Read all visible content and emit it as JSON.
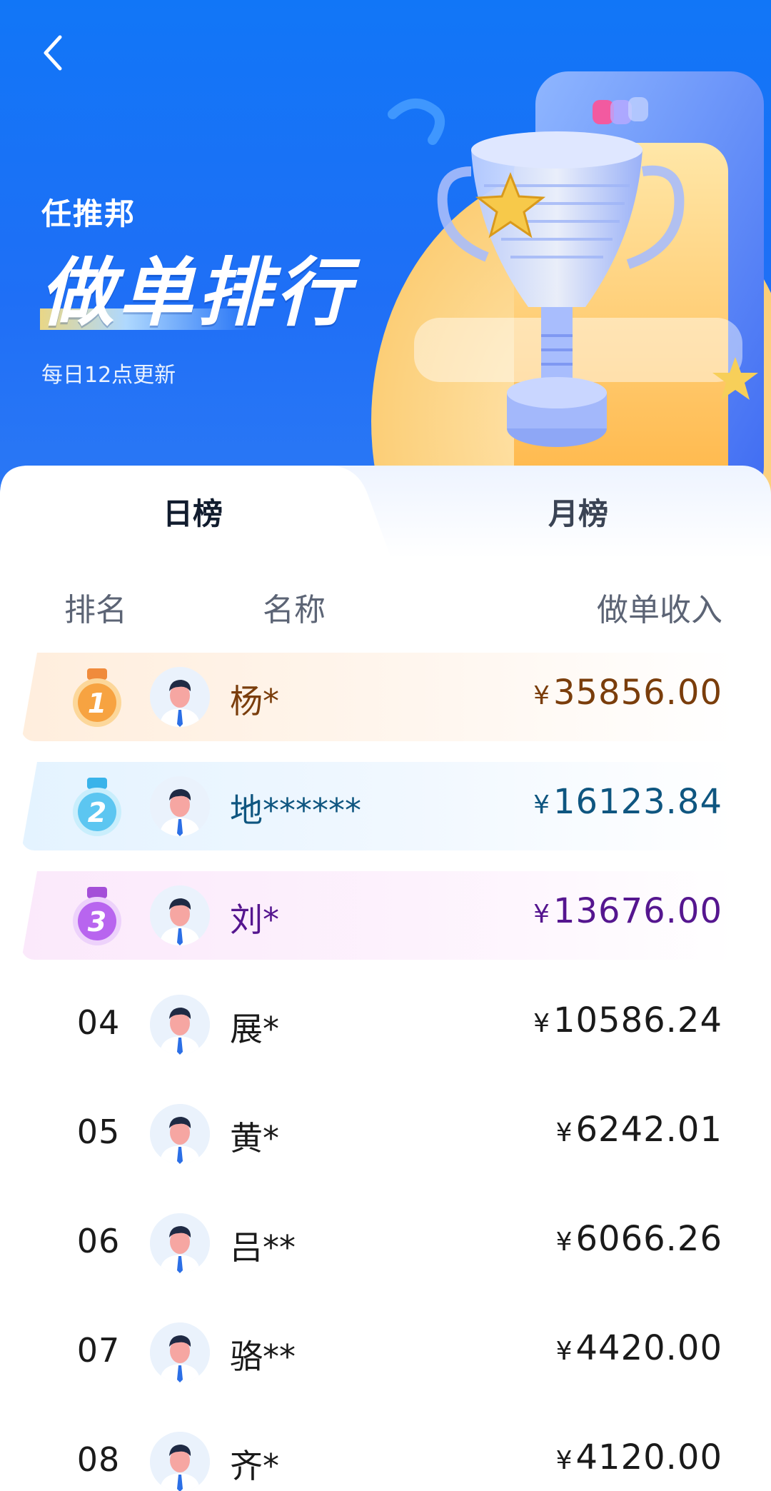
{
  "header": {
    "brand": "任推邦",
    "title": "做单排行",
    "subtitle": "每日12点更新"
  },
  "tabs": [
    {
      "label": "日榜",
      "active": true
    },
    {
      "label": "月榜",
      "active": false
    }
  ],
  "table": {
    "columns": [
      "排名",
      "名称",
      "做单收入"
    ],
    "currency": "¥",
    "rows": [
      {
        "rank": "01",
        "name": "杨*",
        "income": "35856.00"
      },
      {
        "rank": "02",
        "name": "地******",
        "income": "16123.84"
      },
      {
        "rank": "03",
        "name": "刘*",
        "income": "13676.00"
      },
      {
        "rank": "04",
        "name": "展*",
        "income": "10586.24"
      },
      {
        "rank": "05",
        "name": "黄*",
        "income": "6242.01"
      },
      {
        "rank": "06",
        "name": "吕**",
        "income": "6066.26"
      },
      {
        "rank": "07",
        "name": "骆**",
        "income": "4420.00"
      },
      {
        "rank": "08",
        "name": "齐*",
        "income": "4120.00"
      }
    ]
  },
  "colors": {
    "hero_blue": "#1176f7",
    "gold": "#7a3d0b",
    "silver": "#0f5680",
    "bronze": "#55168f"
  },
  "icons": {
    "back": "chevron-left-icon",
    "medals": [
      "medal-1-icon",
      "medal-2-icon",
      "medal-3-icon"
    ],
    "avatar": "user-avatar-icon",
    "trophy": "trophy-illustration"
  }
}
